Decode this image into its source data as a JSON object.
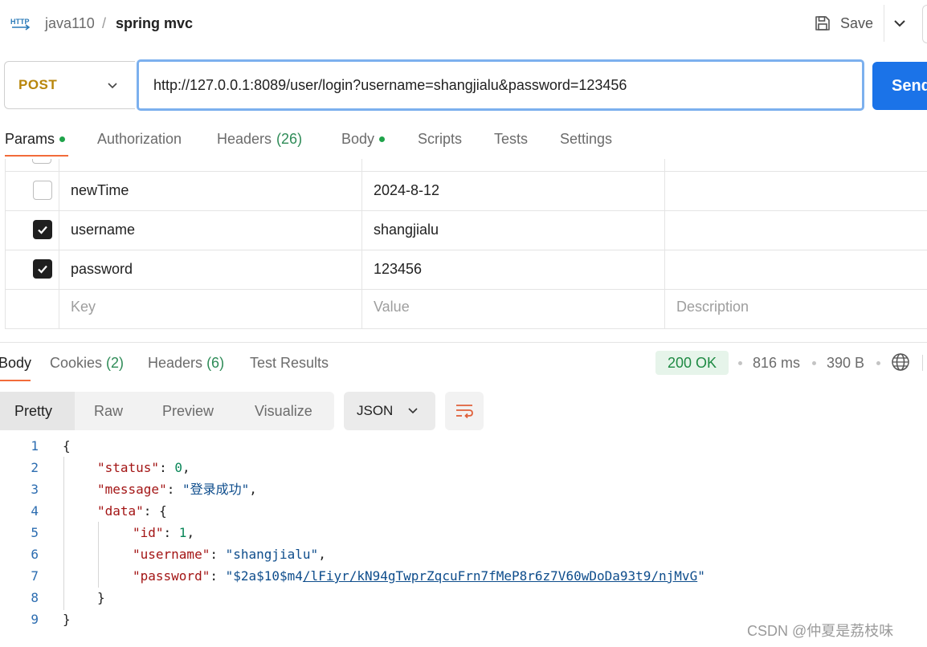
{
  "header": {
    "http_icon_text": "HTTP",
    "workspace": "java110",
    "separator": "/",
    "request_name": "spring mvc",
    "save_label": "Save"
  },
  "request": {
    "method": "POST",
    "url": "http://127.0.0.1:8089/user/login?username=shangjialu&password=123456",
    "send_label": "Send"
  },
  "request_tabs": [
    {
      "label": "Params",
      "dot": true,
      "active": true
    },
    {
      "label": "Authorization"
    },
    {
      "label": "Headers",
      "count": "(26)"
    },
    {
      "label": "Body",
      "dot": true
    },
    {
      "label": "Scripts"
    },
    {
      "label": "Tests"
    },
    {
      "label": "Settings"
    }
  ],
  "params": {
    "rows": [
      {
        "checked": false,
        "key": "newTime",
        "value": "2024-8-12"
      },
      {
        "checked": true,
        "key": "username",
        "value": "shangjialu"
      },
      {
        "checked": true,
        "key": "password",
        "value": "123456"
      }
    ],
    "placeholders": {
      "key": "Key",
      "value": "Value",
      "description": "Description"
    }
  },
  "response_tabs": [
    {
      "label": "Body",
      "active": true
    },
    {
      "label": "Cookies",
      "count": "(2)"
    },
    {
      "label": "Headers",
      "count": "(6)"
    },
    {
      "label": "Test Results"
    }
  ],
  "response_meta": {
    "status": "200 OK",
    "status_color": "#1e8a43",
    "time": "816 ms",
    "size": "390 B"
  },
  "view_modes": [
    "Pretty",
    "Raw",
    "Preview",
    "Visualize"
  ],
  "format": "JSON",
  "code": {
    "line_numbers": [
      "1",
      "2",
      "3",
      "4",
      "5",
      "6",
      "7",
      "8",
      "9"
    ],
    "open_brace": "{",
    "close_brace": "}",
    "status_key": "\"status\"",
    "status_val": "0",
    "message_key": "\"message\"",
    "message_val": "\"登录成功\"",
    "data_key": "\"data\"",
    "id_key": "\"id\"",
    "id_val": "1",
    "username_key": "\"username\"",
    "username_val": "\"shangjialu\"",
    "password_key": "\"password\"",
    "password_val_prefix": "\"$2a$10$m4",
    "password_val_link": "/lFiyr/kN94gTwprZqcuFrn7fMeP8r6z7V60wDoDa93t9/njMvG",
    "password_val_suffix": "\""
  },
  "watermark": "CSDN @仲夏是荔枝味",
  "colors": {
    "accent": "#f26b3a",
    "send": "#1b73e8",
    "method": "#b8860b",
    "json_key": "#a31515",
    "json_string": "#0e4d8c",
    "json_number": "#098658"
  }
}
